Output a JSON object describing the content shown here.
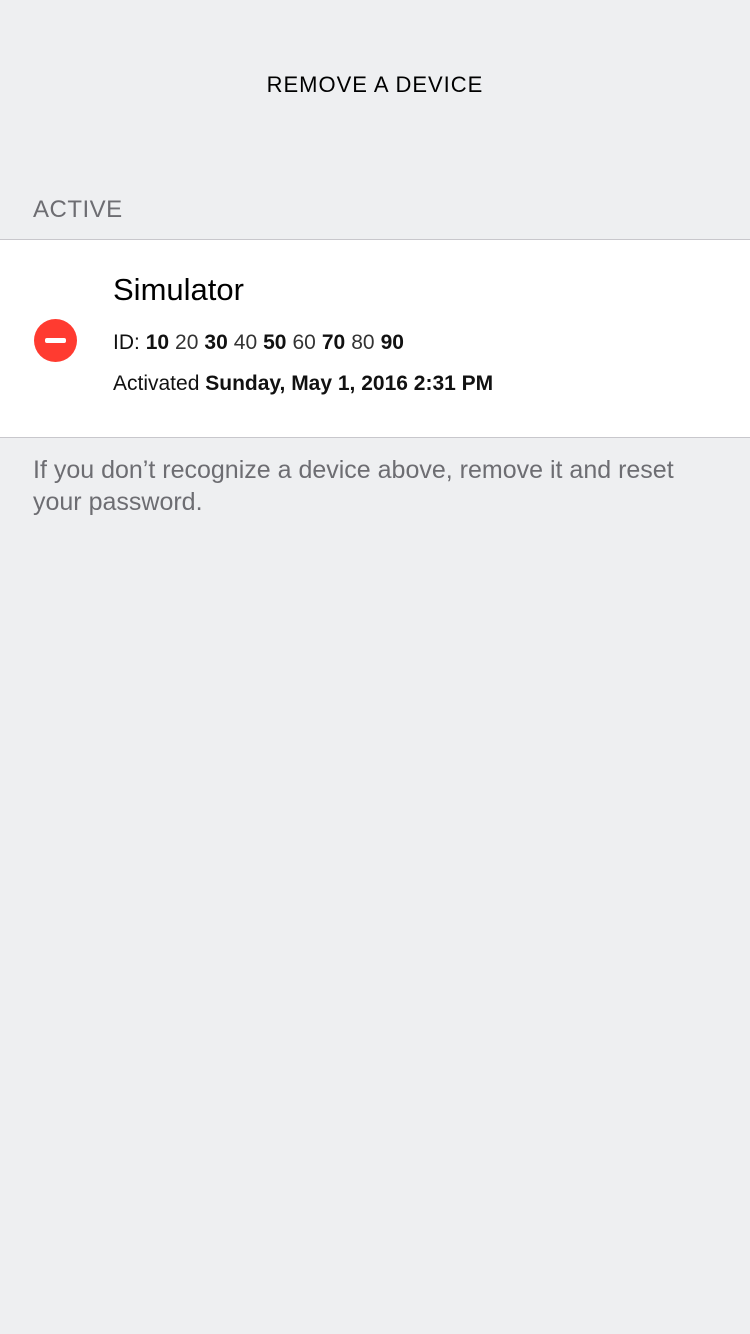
{
  "nav": {
    "title": "REMOVE A DEVICE"
  },
  "section": {
    "header": "ACTIVE"
  },
  "devices": [
    {
      "name": "Simulator",
      "id_label": "ID:",
      "id_segments": [
        "10",
        "20",
        "30",
        "40",
        "50",
        "60",
        "70",
        "80",
        "90"
      ],
      "activated_label": "Activated",
      "activated_date": "Sunday, May 1, 2016 2:31 PM",
      "remove_icon": "minus-circle-icon"
    }
  ],
  "footer": {
    "note": "If you don’t recognize a device above, remove it and reset your password."
  },
  "colors": {
    "background": "#eeeff1",
    "destructive": "#ff3b30",
    "secondary_text": "#6d6d72"
  }
}
